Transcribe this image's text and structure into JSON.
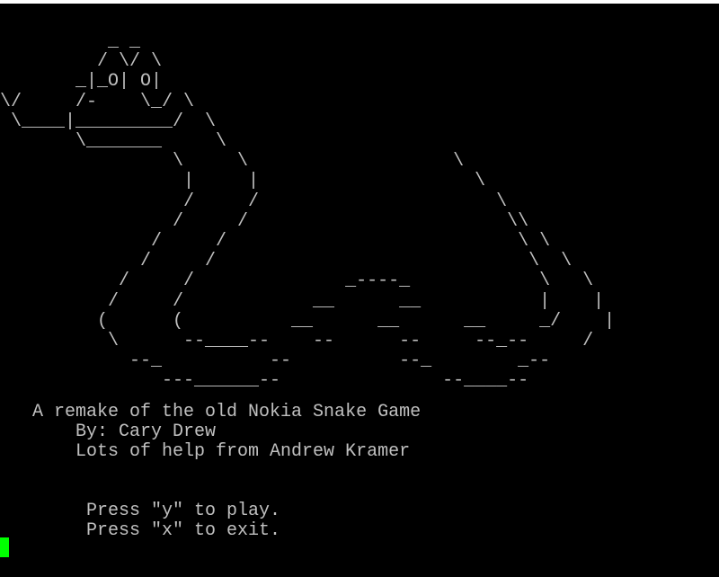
{
  "terminal": {
    "background": "#000000",
    "foreground": "#c0c0c0",
    "cursor_color": "#00ff00"
  },
  "ascii_snake": [
    "          _ _",
    "         / \\/ \\",
    "       _|_O| O|",
    "\\/     /-    \\_/ \\",
    " \\____|_________/  \\",
    "       \\_______     \\",
    "                \\     \\                   \\",
    "                 |     |                    \\",
    "                 /     /                      \\",
    "                /     /                        \\\\",
    "              /     /                           \\ \\",
    "             /     /                             \\  \\",
    "           /     /              _----_            \\   \\",
    "          /     /            __      __           |    |",
    "         (      (          __      __      __     _/    |",
    "          \\      --____--    --      --     --_--     /",
    "            --_          --          --_        _--",
    "               ---______--               --____--"
  ],
  "credits": {
    "title": "   A remake of the old Nokia Snake Game",
    "author": "       By: Cary Drew",
    "thanks": "       Lots of help from Andrew Kramer"
  },
  "prompts": {
    "play": "        Press \"y\" to play.",
    "exit": "        Press \"x\" to exit."
  }
}
